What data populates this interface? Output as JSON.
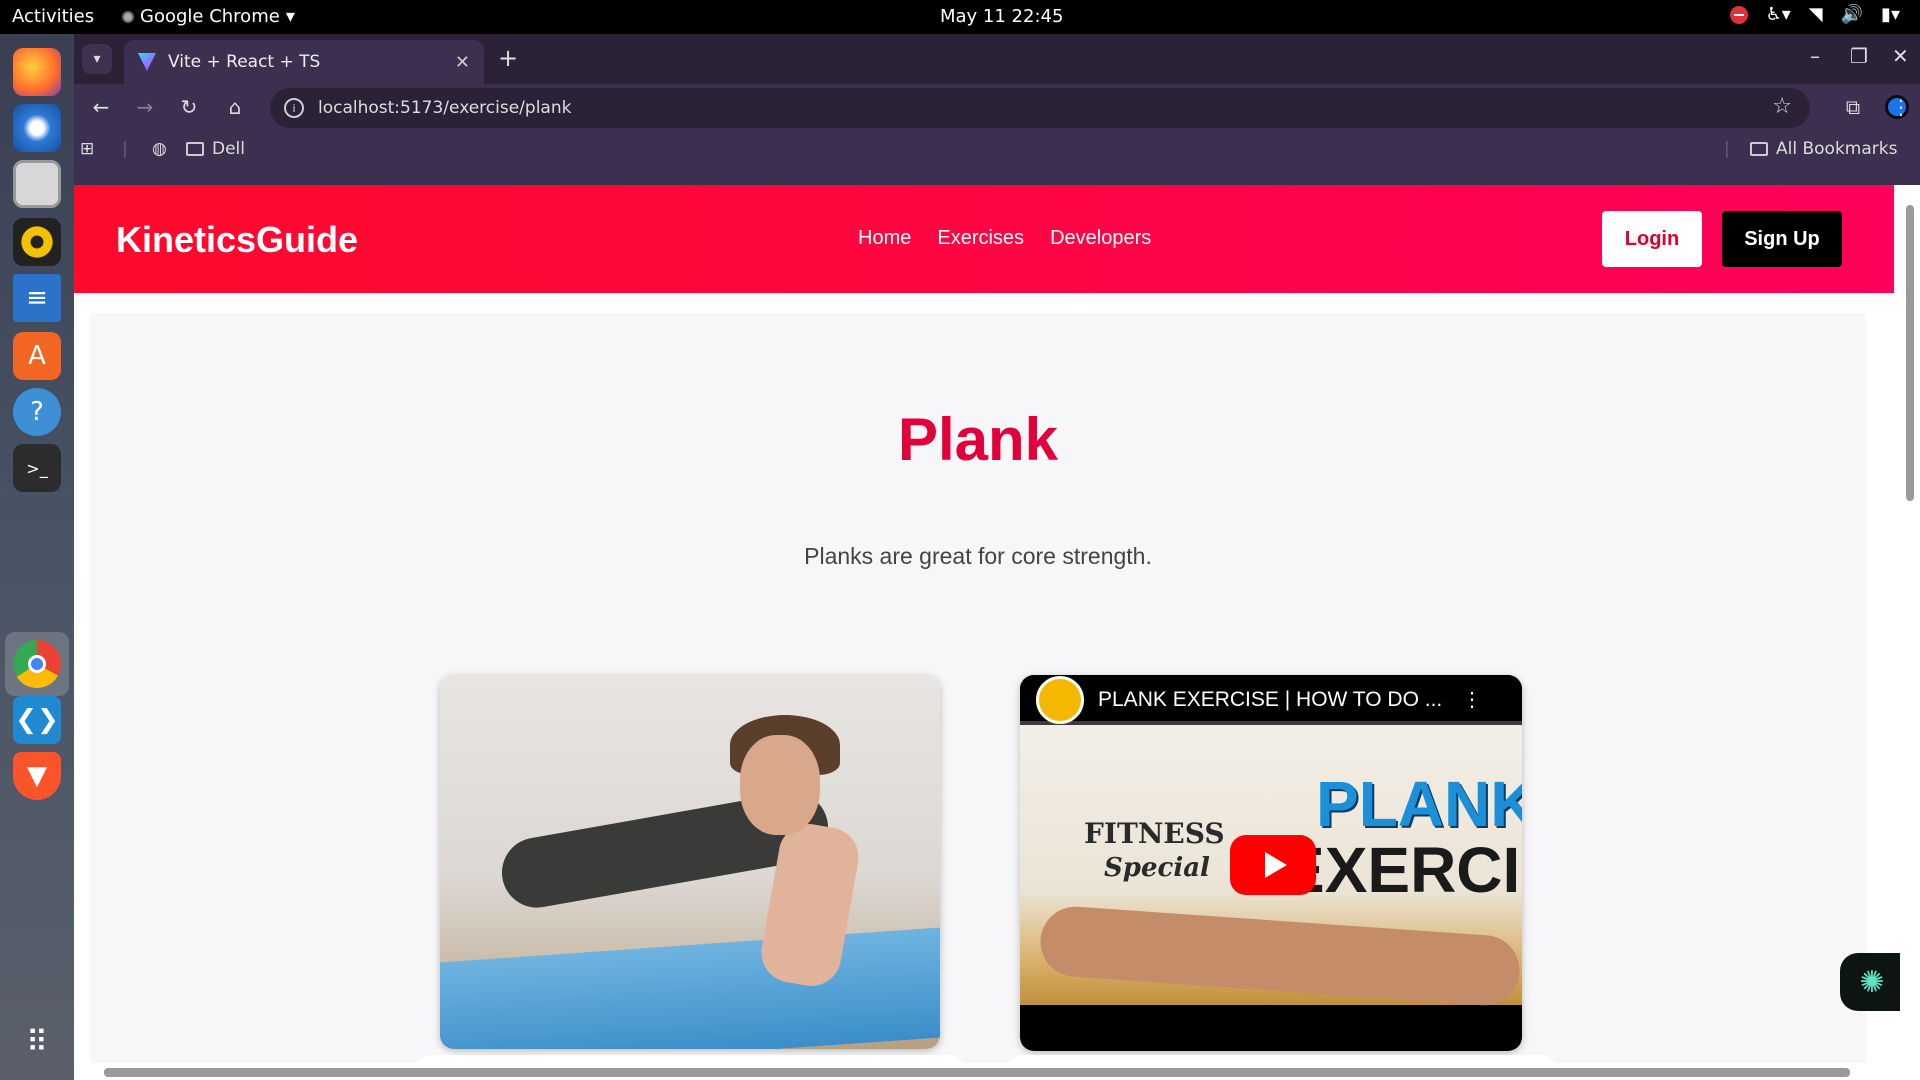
{
  "system_bar": {
    "activities": "Activities",
    "app_name": "Google Chrome",
    "datetime": "May 11  22:45"
  },
  "browser": {
    "tab_title": "Vite + React + TS",
    "url": "localhost:5173/exercise/plank",
    "bookmarks": {
      "folder_dell": "Dell",
      "all_bookmarks": "All Bookmarks"
    }
  },
  "app": {
    "brand": "KineticsGuide",
    "nav": [
      "Home",
      "Exercises",
      "Developers"
    ],
    "login_label": "Login",
    "signup_label": "Sign Up",
    "colors": {
      "accent": "#ff0a2b",
      "accent_end": "#ff005a",
      "title": "#e0003a"
    }
  },
  "exercise": {
    "title": "Plank",
    "description": "Planks are great for core strength.",
    "video": {
      "title": "PLANK EXERCISE | HOW TO DO ...",
      "thumb_text_1": "FITNESS",
      "thumb_text_2": "Special",
      "thumb_text_3": "PLANK",
      "thumb_text_4": "EXERCISE"
    }
  },
  "icons": {
    "dock": [
      "firefox-icon",
      "thunderbird-icon",
      "files-icon",
      "rhythmbox-icon",
      "writer-icon",
      "app-center-icon",
      "help-icon",
      "terminal-icon",
      "chrome-icon",
      "vscode-icon",
      "brave-icon",
      "app-grid-icon"
    ],
    "chat_widget": "chatgpt-icon"
  }
}
